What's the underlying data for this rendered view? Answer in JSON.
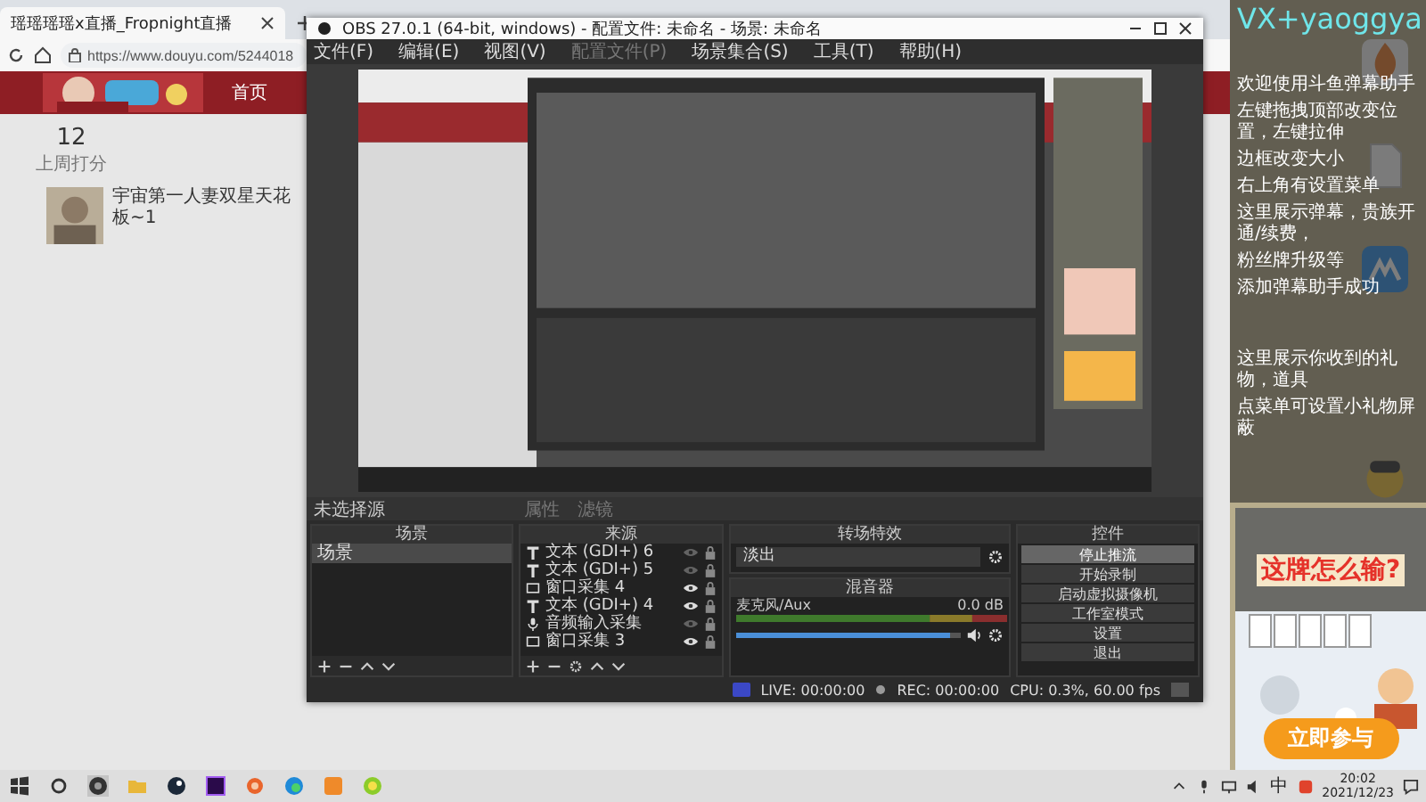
{
  "browser": {
    "tab_title": "瑶瑶瑶瑶x直播_Fropnight直播",
    "url": "https://www.douyu.com/5244018",
    "nav": [
      "首页"
    ],
    "stat": {
      "value": "12",
      "label": "上周打分"
    },
    "room_title": "宇宙第一人妻双星天花板~1"
  },
  "obs": {
    "title": "OBS 27.0.1 (64-bit, windows) - 配置文件: 未命名 - 场景: 未命名",
    "menu": [
      {
        "label": "文件(F)",
        "disabled": false
      },
      {
        "label": "编辑(E)",
        "disabled": false
      },
      {
        "label": "视图(V)",
        "disabled": false
      },
      {
        "label": "配置文件(P)",
        "disabled": true
      },
      {
        "label": "场景集合(S)",
        "disabled": false
      },
      {
        "label": "工具(T)",
        "disabled": false
      },
      {
        "label": "帮助(H)",
        "disabled": false
      }
    ],
    "source_bar": {
      "label": "未选择源",
      "buttons": [
        "属性",
        "滤镜"
      ]
    },
    "scenes": {
      "title": "场景",
      "items": [
        {
          "label": "场景",
          "selected": true
        }
      ]
    },
    "sources": {
      "title": "来源",
      "items": [
        {
          "kind": "text",
          "label": "文本 (GDI+) 6",
          "visible": false
        },
        {
          "kind": "text",
          "label": "文本 (GDI+) 5",
          "visible": false
        },
        {
          "kind": "window",
          "label": "窗口采集 4",
          "visible": true
        },
        {
          "kind": "text",
          "label": "文本 (GDI+) 4",
          "visible": true
        },
        {
          "kind": "audio",
          "label": "音频输入采集",
          "visible": false
        },
        {
          "kind": "window",
          "label": "窗口采集 3",
          "visible": true
        }
      ]
    },
    "transitions": {
      "title": "转场特效",
      "value": "淡出"
    },
    "mixer": {
      "title": "混音器",
      "channel": "麦克风/Aux",
      "reading": "0.0 dB",
      "level": 0.95
    },
    "controls": {
      "title": "控件",
      "buttons": [
        {
          "label": "停止推流",
          "active": true
        },
        {
          "label": "开始录制",
          "active": false
        },
        {
          "label": "启动虚拟摄像机",
          "active": false
        },
        {
          "label": "工作室模式",
          "active": false
        },
        {
          "label": "设置",
          "active": false
        },
        {
          "label": "退出",
          "active": false
        }
      ]
    },
    "status": {
      "live": "LIVE: 00:00:00",
      "rec": "REC: 00:00:00",
      "cpu": "CPU: 0.3%, 60.00 fps"
    }
  },
  "overlay": {
    "title": "VX+yaoggya",
    "messages": [
      "欢迎使用斗鱼弹幕助手",
      "左键拖拽顶部改变位置，左键拉伸",
      "边框改变大小",
      "右上角有设置菜单",
      "这里展示弹幕，贵族开通/续费，",
      "粉丝牌升级等",
      "添加弹幕助手成功"
    ],
    "gift_messages": [
      "这里展示你收到的礼物，道具",
      "点菜单可设置小礼物屏蔽"
    ]
  },
  "ad": {
    "headline": "这牌怎么输?",
    "button": "立即参与"
  },
  "taskbar": {
    "ime": "中",
    "time": "20:02",
    "date": "2021/12/23"
  }
}
